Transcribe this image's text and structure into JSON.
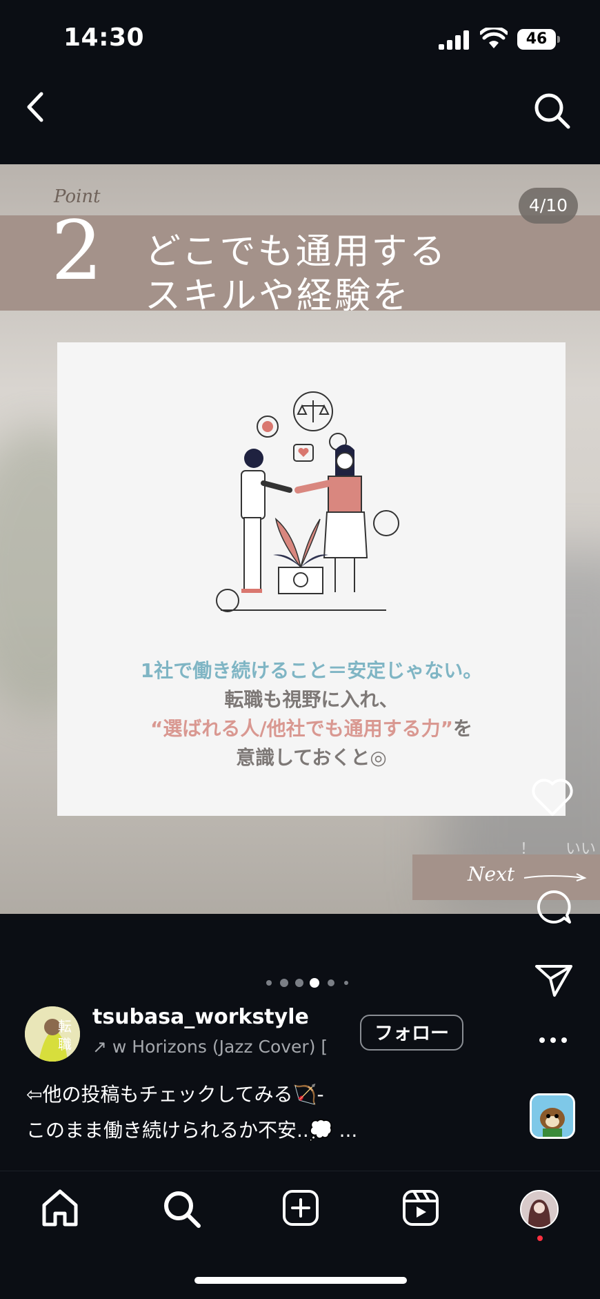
{
  "status_bar": {
    "time": "14:30",
    "battery": "46"
  },
  "post": {
    "point_label": "Point",
    "point_number": "2",
    "title_line1": "どこでも通用する",
    "title_line2": "スキルや経験を",
    "page_indicator": "4/10",
    "message_line1": "1社で働き続けること＝安定じゃない。",
    "message_line2": "転職も視野に入れ、",
    "message_line3_highlight": "“選ばれる人/他社でも通用する力”",
    "message_line3_tail": "を",
    "message_line4": "意識しておくと◎",
    "next_label": "Next",
    "like_hint": "！　　いい",
    "carousel": {
      "dot_count": 6,
      "active_index": 3
    }
  },
  "account": {
    "username": "tsubasa_workstyle",
    "music": "w Horizons (Jazz Cover) [",
    "follow_label": "フォロー",
    "avatar_text": "転職"
  },
  "caption": {
    "line1": "⇦他の投稿もチェックしてみる🏹-",
    "line2": "このまま働き続けられるか不安..💭 ..."
  },
  "colors": {
    "accent_band": "#a4928a",
    "teal_text": "#7fb5c4",
    "pink_text": "#d99891",
    "notification_dot": "#ff3040"
  },
  "icons": [
    "back-icon",
    "search-icon",
    "heart-icon",
    "comment-icon",
    "share-icon",
    "more-icon",
    "home-icon",
    "create-icon",
    "reels-icon"
  ]
}
